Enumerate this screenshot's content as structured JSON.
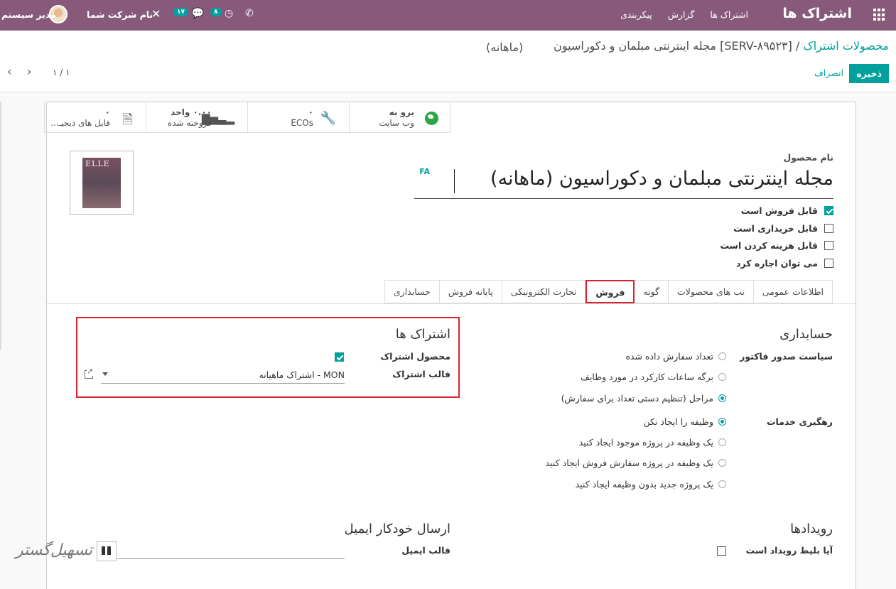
{
  "navbar": {
    "app_title": "اشتراک ها",
    "menu": [
      "اشتراک ها",
      "گزارش",
      "پیکربندی"
    ],
    "user_name": "مدیر سیستم",
    "company": "نام شرکت شما",
    "messages_count": "۱۷",
    "activities_count": "۸"
  },
  "breadcrumb": {
    "parent": "محصولات اشتراک",
    "separator": "/",
    "current_line1": "[SERV-۸۹۵۲۳] مجله اینترنتی مبلمان و دکوراسیون",
    "current_line2": "(ماهانه)"
  },
  "actions": {
    "save": "ذخیره",
    "discard": "انصراف",
    "pager": "۱ / ۱"
  },
  "stat_buttons": [
    {
      "icon": "globe-icon",
      "line1": "برو به",
      "line2": "وب سایت"
    },
    {
      "icon": "wrench-icon",
      "line1": "۰",
      "line2": "ECOs"
    },
    {
      "icon": "chart-icon",
      "line1": "۰.۰۰ واحد",
      "line2": "فروخته شده"
    },
    {
      "icon": "file-icon",
      "line1": "۰",
      "line2": "فایل های دیجیـ..."
    }
  ],
  "product": {
    "name_label": "نام محصول",
    "name": "مجله اینترنتی مبلمان و دکوراسیون (ماهانه)",
    "lang": "FA",
    "image_text": "ELLE DECORATION"
  },
  "checkboxes": [
    {
      "label": "قابل فروش است",
      "checked": true
    },
    {
      "label": "قابل خریداری است",
      "checked": false
    },
    {
      "label": "قابل هزینه کردن است",
      "checked": false
    },
    {
      "label": "می توان اجاره کرد",
      "checked": false
    }
  ],
  "tabs": [
    "اطلاعات عمومی",
    "تب های محصولات",
    "گونه",
    "فروش",
    "تجارت الکترونیکی",
    "پایانه فروش",
    "حسابداری"
  ],
  "active_tab": "فروش",
  "accounting": {
    "title": "حسابداری",
    "invoice_policy_label": "سیاست صدور فاکتور",
    "invoice_options": [
      {
        "label": "تعداد سفارش داده شده",
        "selected": false
      },
      {
        "label": "برگه ساعات کارکرد در مورد وظایف",
        "selected": false
      },
      {
        "label": "مراحل (تنظیم دستی تعداد برای سفارش)",
        "selected": true
      }
    ],
    "service_tracking_label": "رهگیری خدمات",
    "tracking_options": [
      {
        "label": "وظیفه را ایجاد نکن",
        "selected": true
      },
      {
        "label": "یک وظیفه در پروژه موجود ایجاد کنید",
        "selected": false
      },
      {
        "label": "یک وظیفه در پروژه سفارش فروش ایجاد کنید",
        "selected": false
      },
      {
        "label": "یک پروژه جدید بدون وظیفه ایجاد کنید",
        "selected": false
      }
    ]
  },
  "subscriptions": {
    "title": "اشتراک ها",
    "product_label": "محصول اشتراک",
    "product_checked": true,
    "template_label": "قالب اشتراک",
    "template_value": "MON - اشتراک ماهیانه"
  },
  "events": {
    "title": "رویدادها",
    "ticket_label": "آیا بلیط رویداد است",
    "ticket_checked": false
  },
  "email": {
    "title": "ارسال خودکار ایمیل",
    "template_label": "قالب ایمیل",
    "template_value": ""
  },
  "watermark": {
    "text": "تسهیل‌گستر"
  }
}
